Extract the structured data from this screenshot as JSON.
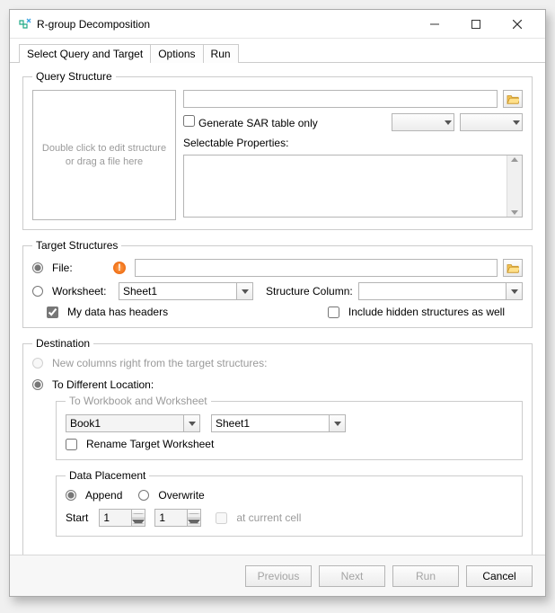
{
  "window": {
    "title": "R-group Decomposition"
  },
  "tabs": {
    "active": "Select Query and Target",
    "options": "Options",
    "run": "Run"
  },
  "query": {
    "legend": "Query Structure",
    "sketch_hint": "Double click to edit structure or drag a file here",
    "gen_sar": "Generate SAR table only",
    "selectable_props": "Selectable Properties:"
  },
  "target": {
    "legend": "Target Structures",
    "file_label": "File:",
    "worksheet_label": "Worksheet:",
    "worksheet_value": "Sheet1",
    "structure_col_label": "Structure Column:",
    "headers_label": "My data has headers",
    "include_hidden_label": "Include hidden structures as well"
  },
  "dest": {
    "legend": "Destination",
    "new_cols_label": "New columns right from the target structures:",
    "diff_loc_label": "To Different Location:",
    "wb_legend": "To Workbook and Worksheet",
    "workbook_value": "Book1",
    "sheet_value": "Sheet1",
    "rename_label": "Rename Target Worksheet",
    "dp_legend": "Data Placement",
    "append_label": "Append",
    "overwrite_label": "Overwrite",
    "start_label": "Start",
    "start_row": "1",
    "start_col": "1",
    "at_cell_label": "at current cell"
  },
  "footer": {
    "prev": "Previous",
    "next": "Next",
    "run": "Run",
    "cancel": "Cancel"
  }
}
